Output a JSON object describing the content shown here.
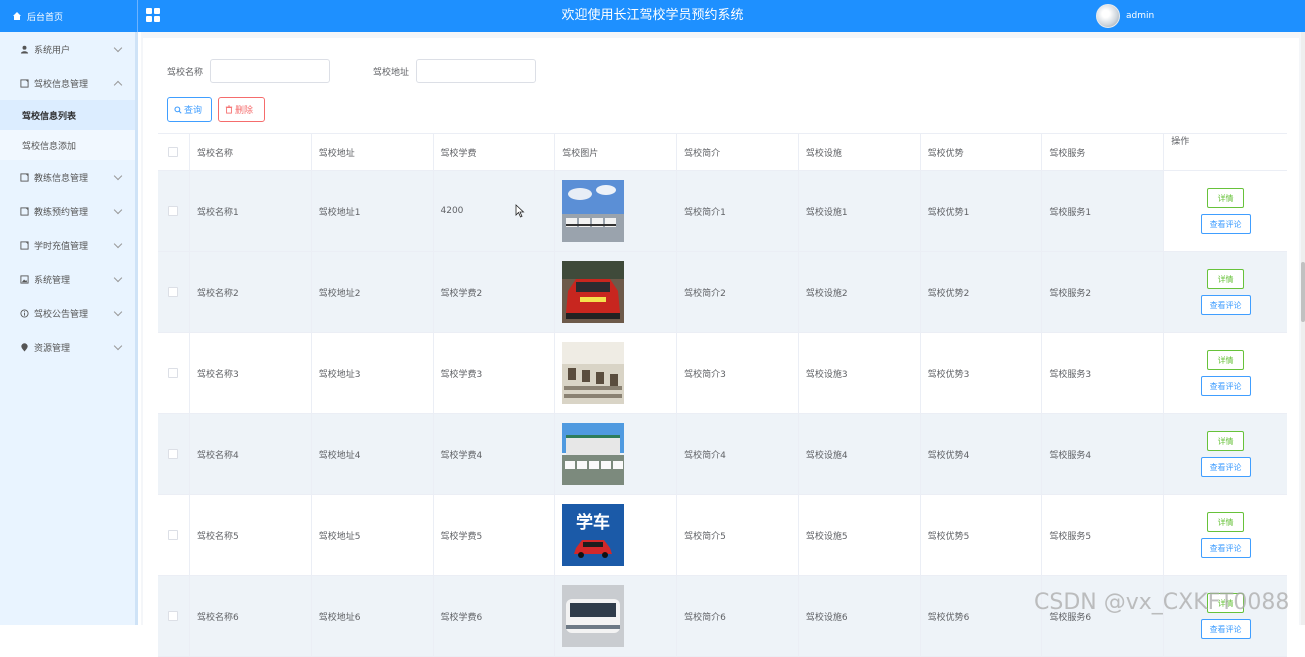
{
  "header": {
    "brand_label": "后台首页",
    "title": "欢迎使用长江驾校学员预约系统",
    "user_name": "admin"
  },
  "sidebar": {
    "items": [
      {
        "label": "系统用户",
        "icon": "user-icon"
      },
      {
        "label": "驾校信息管理",
        "icon": "document-icon",
        "expanded": true
      },
      {
        "label": "教练信息管理",
        "icon": "document-icon"
      },
      {
        "label": "教练预约管理",
        "icon": "document-icon"
      },
      {
        "label": "学时充值管理",
        "icon": "document-icon"
      },
      {
        "label": "系统管理",
        "icon": "image-icon"
      },
      {
        "label": "驾校公告管理",
        "icon": "info-icon"
      },
      {
        "label": "资源管理",
        "icon": "location-icon"
      }
    ],
    "sub_items": [
      {
        "label": "驾校信息列表",
        "active": true
      },
      {
        "label": "驾校信息添加",
        "active": false
      }
    ]
  },
  "filters": {
    "name_label": "驾校名称",
    "name_value": "",
    "address_label": "驾校地址",
    "address_value": ""
  },
  "buttons": {
    "query_label": "查询",
    "delete_label": "删除"
  },
  "table": {
    "headers": [
      "驾校名称",
      "驾校地址",
      "驾校学费",
      "驾校图片",
      "驾校简介",
      "驾校设施",
      "驾校优势",
      "驾校服务",
      "操作"
    ],
    "rows": [
      {
        "name": "驾校名称1",
        "address": "驾校地址1",
        "fee": "4200",
        "intro": "驾校简介1",
        "facility": "驾校设施1",
        "advantage": "驾校优势1",
        "service": "驾校服务1",
        "image": "bus-fleet"
      },
      {
        "name": "驾校名称2",
        "address": "驾校地址2",
        "fee": "驾校学费2",
        "intro": "驾校简介2",
        "facility": "驾校设施2",
        "advantage": "驾校优势2",
        "service": "驾校服务2",
        "image": "red-car"
      },
      {
        "name": "驾校名称3",
        "address": "驾校地址3",
        "fee": "驾校学费3",
        "intro": "驾校简介3",
        "facility": "驾校设施3",
        "advantage": "驾校优势3",
        "service": "驾校服务3",
        "image": "classroom"
      },
      {
        "name": "驾校名称4",
        "address": "驾校地址4",
        "fee": "驾校学费4",
        "intro": "驾校简介4",
        "facility": "驾校设施4",
        "advantage": "驾校优势4",
        "service": "驾校服务4",
        "image": "building-cars"
      },
      {
        "name": "驾校名称5",
        "address": "驾校地址5",
        "fee": "驾校学费5",
        "intro": "驾校简介5",
        "facility": "驾校设施5",
        "advantage": "驾校优势5",
        "service": "驾校服务5",
        "image": "xueche-sign",
        "image_text": "学车"
      },
      {
        "name": "驾校名称6",
        "address": "驾校地址6",
        "fee": "驾校学费6",
        "intro": "驾校简介6",
        "facility": "驾校设施6",
        "advantage": "驾校优势6",
        "service": "驾校服务6",
        "image": "bus"
      }
    ],
    "detail_label": "详情",
    "review_label": "查看评论"
  },
  "watermark": "CSDN @vx_CXKFT0088",
  "colors": {
    "topbar": "#1e90ff",
    "sidebar": "#e9f4ff",
    "primary": "#409eff",
    "success": "#67c23a",
    "danger": "#f56c6c"
  }
}
